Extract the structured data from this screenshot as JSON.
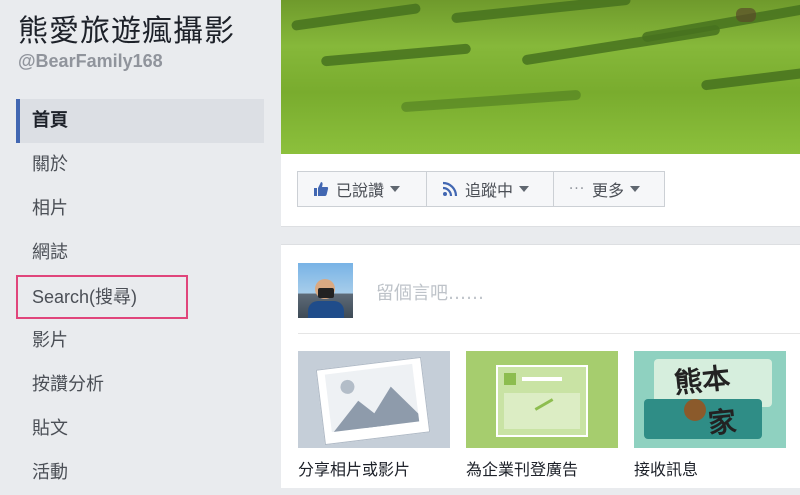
{
  "sidebar": {
    "title": "熊愛旅遊瘋攝影",
    "handle": "@BearFamily168",
    "items": [
      {
        "label": "首頁"
      },
      {
        "label": "關於"
      },
      {
        "label": "相片"
      },
      {
        "label": "網誌"
      },
      {
        "label": "Search(搜尋)"
      },
      {
        "label": "影片"
      },
      {
        "label": "按讚分析"
      },
      {
        "label": "貼文"
      },
      {
        "label": "活動"
      }
    ]
  },
  "actions": {
    "liked_label": "已說讚",
    "following_label": "追蹤中",
    "more_label": "更多"
  },
  "composer": {
    "placeholder": "留個言吧……",
    "cards": [
      {
        "label": "分享相片或影片"
      },
      {
        "label": "為企業刊登廣告"
      },
      {
        "label": "接收訊息"
      }
    ],
    "watermark_text": "熊本一家"
  },
  "colors": {
    "accent": "#4267b2",
    "highlight_border": "#e0457b",
    "card_photo": "#c5ced8",
    "card_ad": "#a6cd6e",
    "card_msg": "#8fd1c0"
  },
  "icons": [
    "thumbs-up-icon",
    "rss-icon",
    "dots-icon",
    "photo-icon",
    "ad-icon",
    "message-icon"
  ]
}
